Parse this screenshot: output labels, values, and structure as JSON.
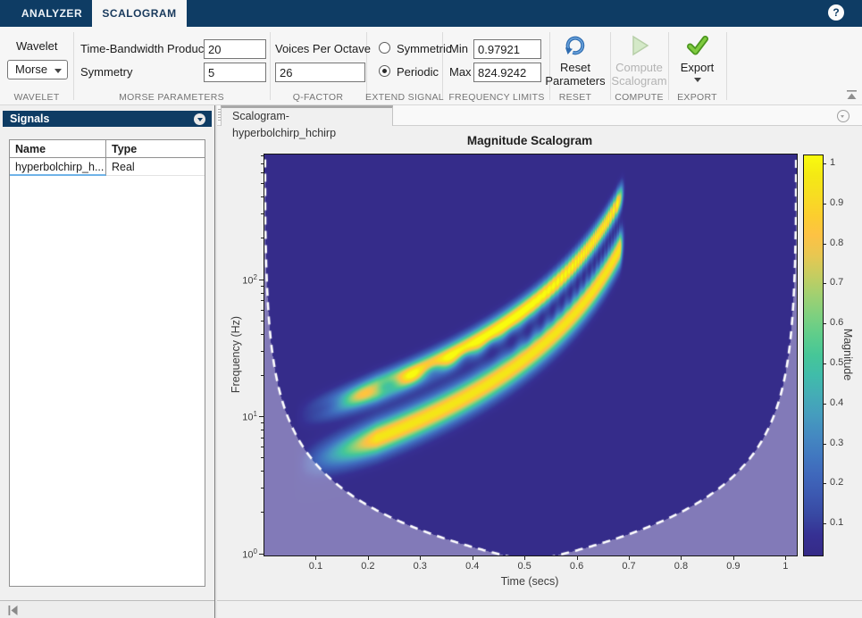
{
  "app": {
    "tab_analyzer": "ANALYZER",
    "tab_scalogram": "SCALOGRAM",
    "help": "?"
  },
  "ribbon": {
    "wavelet": {
      "label": "Wavelet",
      "value": "Morse",
      "caption": "WAVELET"
    },
    "morse": {
      "tbp_label": "Time-Bandwidth Product",
      "tbp_value": "20",
      "symmetry_label": "Symmetry",
      "symmetry_value": "5",
      "caption": "MORSE PARAMETERS"
    },
    "qfactor": {
      "label": "Voices Per Octave",
      "value": "26",
      "caption": "Q-FACTOR"
    },
    "extend": {
      "symmetric": "Symmetric",
      "periodic": "Periodic",
      "selected": "Periodic",
      "caption": "EXTEND SIGNAL"
    },
    "freq": {
      "min_label": "Min",
      "min_value": "0.97921",
      "max_label": "Max",
      "max_value": "824.9242",
      "caption": "FREQUENCY LIMITS"
    },
    "reset": {
      "line1": "Reset",
      "line2": "Parameters",
      "caption": "RESET"
    },
    "compute": {
      "line1": "Compute",
      "line2": "Scalogram",
      "caption": "COMPUTE",
      "disabled": true
    },
    "export": {
      "label": "Export",
      "caption": "EXPORT"
    }
  },
  "signals_panel": {
    "title": "Signals",
    "columns": {
      "name": "Name",
      "type": "Type"
    },
    "rows": [
      {
        "name": "hyperbolchirp_h...",
        "type": "Real"
      }
    ]
  },
  "main": {
    "doc_tab": "Scalogram-hyperbolchirp_hchirp"
  },
  "chart_data": {
    "type": "heatmap",
    "title": "Magnitude Scalogram",
    "xlabel": "Time (secs)",
    "ylabel": "Frequency (Hz)",
    "colorbar_label": "Magnitude",
    "x_range": [
      0,
      1.02
    ],
    "y_scale": "log",
    "y_range": [
      0.97921,
      824.9242
    ],
    "x_ticks": [
      {
        "v": 0.1,
        "label": "0.1"
      },
      {
        "v": 0.2,
        "label": "0.2"
      },
      {
        "v": 0.3,
        "label": "0.3"
      },
      {
        "v": 0.4,
        "label": "0.4"
      },
      {
        "v": 0.5,
        "label": "0.5"
      },
      {
        "v": 0.6,
        "label": "0.6"
      },
      {
        "v": 0.7,
        "label": "0.7"
      },
      {
        "v": 0.8,
        "label": "0.8"
      },
      {
        "v": 0.9,
        "label": "0.9"
      },
      {
        "v": 1.0,
        "label": "1"
      }
    ],
    "y_ticks": [
      {
        "v": 1,
        "exp": "0"
      },
      {
        "v": 10,
        "exp": "1"
      },
      {
        "v": 100,
        "exp": "2"
      }
    ],
    "colorbar_range": [
      0.0223,
      1.0223
    ],
    "colorbar_ticks": [
      {
        "v": 0.1,
        "label": "0.1"
      },
      {
        "v": 0.2,
        "label": "0.2"
      },
      {
        "v": 0.3,
        "label": "0.3"
      },
      {
        "v": 0.4,
        "label": "0.4"
      },
      {
        "v": 0.5,
        "label": "0.5"
      },
      {
        "v": 0.6,
        "label": "0.6"
      },
      {
        "v": 0.7,
        "label": "0.7"
      },
      {
        "v": 0.8,
        "label": "0.8"
      },
      {
        "v": 0.9,
        "label": "0.9"
      },
      {
        "v": 1.0,
        "label": "1"
      }
    ],
    "colormap": "parula",
    "parula_stops": [
      "#352a87",
      "#363093",
      "#3848a2",
      "#3c58b0",
      "#3f67bb",
      "#4178c0",
      "#4489c1",
      "#459cbe",
      "#44acb6",
      "#40bcaa",
      "#46c698",
      "#5ecd8b",
      "#7ed07f",
      "#a0d071",
      "#c5cd60",
      "#e8c751",
      "#fdc244",
      "#fcce2e",
      "#f7dd22",
      "#f4e914",
      "#f9fb0e"
    ],
    "signal_model": {
      "description": "two hyperbolic chirps, magnitude CWT",
      "t_singularity": 0.8,
      "if_coef_1": 5.5,
      "if_coef_2": 2.4,
      "amp_1": 1.04,
      "amp_2": 0.93,
      "sigma_1": 0.085,
      "sigma_2": 0.115,
      "cutoff_time": 0.68,
      "onset_time": 0.055,
      "onset_width": 0.16,
      "beat_coef": 3.1,
      "dot_sigma": 0.07,
      "dot_depth": 0.55,
      "base_level": 0.035
    },
    "coi": {
      "k": 0.45,
      "style": "dashed-white",
      "shade_alpha": 0.44,
      "shade_tint": [
        227,
        223,
        243
      ]
    }
  }
}
